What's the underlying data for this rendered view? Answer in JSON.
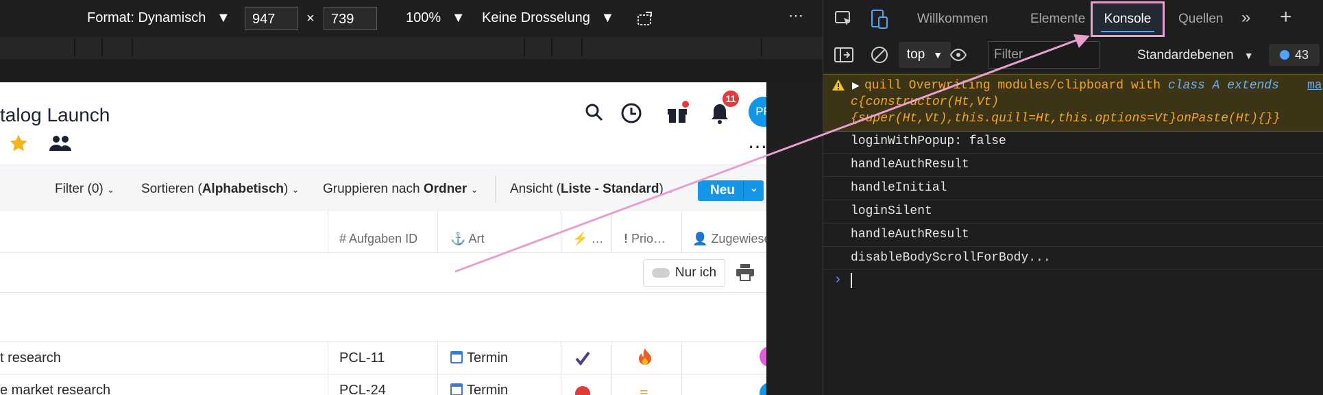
{
  "device_toolbar": {
    "format_label": "Format: Dynamisch",
    "width_value": "947",
    "times": "×",
    "height_value": "739",
    "zoom": "100%",
    "throttle": "Keine Drosselung"
  },
  "app": {
    "title": "talog Launch",
    "notification_count": "11",
    "avatar_initials": "PR",
    "filter": {
      "prefix": "Filter ",
      "value": "(0)"
    },
    "sort": {
      "prefix": "Sortieren (",
      "value": "Alphabetisch",
      "suffix": ")"
    },
    "group": {
      "prefix": "Gruppieren nach ",
      "value": "Ordner"
    },
    "view": {
      "prefix": "Ansicht (",
      "value": "Liste - Standard",
      "suffix": ")"
    },
    "new_button": "Neu",
    "columns": [
      "Aufgaben ID",
      "Art",
      "…",
      "Prio…",
      "Zugewiese"
    ],
    "only_me": "Nur ich",
    "rows": [
      {
        "name": "t research",
        "id": "PCL-11",
        "type": "Termin"
      },
      {
        "name": "e market research",
        "id": "PCL-24",
        "type": "Termin"
      }
    ]
  },
  "devtools": {
    "tabs": {
      "welcome": "Willkommen",
      "elements": "Elemente",
      "console": "Konsole",
      "sources": "Quellen"
    },
    "context": "top",
    "filter_placeholder": "Filter",
    "levels": "Standardebenen",
    "message_count": "43",
    "warning": {
      "line1_a": "quill Overwriting modules/clipboard with ",
      "line1_b": "class A extends",
      "link": "ma",
      "line2": "c{constructor(Ht,Vt)",
      "line3": "{super(Ht,Vt),this.quill=Ht,this.options=Vt}onPaste(Ht){}}"
    },
    "logs": [
      "loginWithPopup: false",
      "handleAuthResult",
      "handleInitial",
      "loginSilent",
      "handleAuthResult",
      "disableBodyScrollForBody..."
    ],
    "prompt": "›"
  },
  "colors": {
    "accent": "#1196e8",
    "highlight": "#e7a0d0",
    "warning_text": "#f5a623"
  }
}
